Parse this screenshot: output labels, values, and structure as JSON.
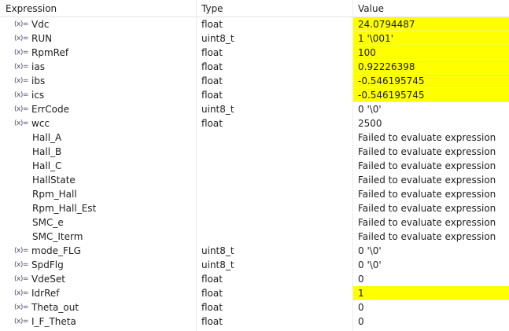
{
  "header": {
    "expression": "Expression",
    "type": "Type",
    "value": "Value"
  },
  "icon_glyph": "(x)=",
  "highlight_color": "#ffff00",
  "rows": [
    {
      "name": "Vdc",
      "type": "float",
      "value": "24.0794487",
      "changed": true,
      "icon": true
    },
    {
      "name": "RUN",
      "type": "uint8_t",
      "value": "1 '\\001'",
      "changed": true,
      "icon": true
    },
    {
      "name": "RpmRef",
      "type": "float",
      "value": "100",
      "changed": true,
      "icon": true
    },
    {
      "name": "ias",
      "type": "float",
      "value": "0.92226398",
      "changed": true,
      "icon": true
    },
    {
      "name": "ibs",
      "type": "float",
      "value": "-0.546195745",
      "changed": true,
      "icon": true
    },
    {
      "name": "ics",
      "type": "float",
      "value": "-0.546195745",
      "changed": true,
      "icon": true
    },
    {
      "name": "ErrCode",
      "type": "uint8_t",
      "value": "0 '\\0'",
      "changed": false,
      "icon": true
    },
    {
      "name": "wcc",
      "type": "float",
      "value": "2500",
      "changed": false,
      "icon": true
    },
    {
      "name": "Hall_A",
      "type": "",
      "value": "Failed to evaluate expression",
      "changed": false,
      "icon": false
    },
    {
      "name": "Hall_B",
      "type": "",
      "value": "Failed to evaluate expression",
      "changed": false,
      "icon": false
    },
    {
      "name": "Hall_C",
      "type": "",
      "value": "Failed to evaluate expression",
      "changed": false,
      "icon": false
    },
    {
      "name": "HallState",
      "type": "",
      "value": "Failed to evaluate expression",
      "changed": false,
      "icon": false
    },
    {
      "name": "Rpm_Hall",
      "type": "",
      "value": "Failed to evaluate expression",
      "changed": false,
      "icon": false
    },
    {
      "name": "Rpm_Hall_Est",
      "type": "",
      "value": "Failed to evaluate expression",
      "changed": false,
      "icon": false
    },
    {
      "name": "SMC_e",
      "type": "",
      "value": "Failed to evaluate expression",
      "changed": false,
      "icon": false
    },
    {
      "name": "SMC_Iterm",
      "type": "",
      "value": "Failed to evaluate expression",
      "changed": false,
      "icon": false
    },
    {
      "name": "mode_FLG",
      "type": "uint8_t",
      "value": "0 '\\0'",
      "changed": false,
      "icon": true
    },
    {
      "name": "SpdFlg",
      "type": "uint8_t",
      "value": "0 '\\0'",
      "changed": false,
      "icon": true
    },
    {
      "name": "VdeSet",
      "type": "float",
      "value": "0",
      "changed": false,
      "icon": true
    },
    {
      "name": "IdrRef",
      "type": "float",
      "value": "1",
      "changed": true,
      "icon": true
    },
    {
      "name": "Theta_out",
      "type": "float",
      "value": "0",
      "changed": false,
      "icon": true
    },
    {
      "name": "I_F_Theta",
      "type": "float",
      "value": "0",
      "changed": false,
      "icon": true
    }
  ]
}
